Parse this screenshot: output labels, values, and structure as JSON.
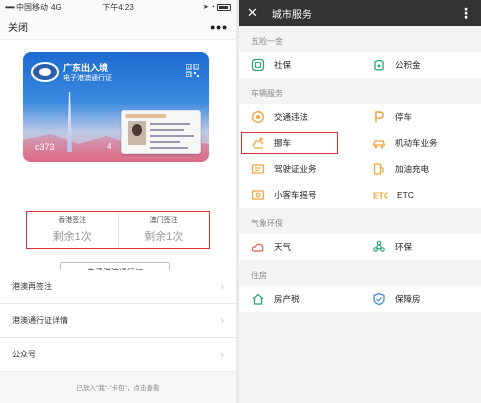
{
  "left": {
    "status": {
      "carrier": "中国移动",
      "network": "4G",
      "time": "下午4:23"
    },
    "nav": {
      "close_label": "关闭",
      "more_label": "•••"
    },
    "card": {
      "title": "广东出入境",
      "subtitle": "电子港澳通行证",
      "number_prefix": "c373",
      "number_suffix": "4"
    },
    "quota": [
      {
        "label": "香港签注",
        "value": "剩余1次"
      },
      {
        "label": "澳门签注",
        "value": "剩余1次"
      }
    ],
    "eep_button": "电子港澳通行证",
    "list": [
      {
        "label": "港澳再签注",
        "chevron": "›"
      },
      {
        "label": "港澳通行证详情",
        "chevron": "›"
      },
      {
        "label": "公众号",
        "chevron": "›"
      }
    ],
    "footer_note": "已放入\"我\"-\"卡包\"，点击查看"
  },
  "right": {
    "header": {
      "close_label": "✕",
      "title": "城市服务",
      "more_label": "⋮"
    },
    "sections": [
      {
        "title": "五险一金",
        "items": [
          {
            "label": "社保",
            "icon": "social-security-icon"
          },
          {
            "label": "公积金",
            "icon": "provident-fund-icon"
          }
        ]
      },
      {
        "title": "车辆服务",
        "items": [
          {
            "label": "交通违法",
            "icon": "traffic-violation-icon"
          },
          {
            "label": "停车",
            "icon": "parking-icon"
          },
          {
            "label": "挪车",
            "icon": "move-car-icon"
          },
          {
            "label": "机动车业务",
            "icon": "vehicle-business-icon"
          },
          {
            "label": "驾驶证业务",
            "icon": "driver-license-icon"
          },
          {
            "label": "加油充电",
            "icon": "fuel-charge-icon"
          },
          {
            "label": "小客车摇号",
            "icon": "car-lottery-icon"
          },
          {
            "label": "ETC",
            "icon": "etc-icon"
          }
        ]
      },
      {
        "title": "气象环保",
        "items": [
          {
            "label": "天气",
            "icon": "weather-icon"
          },
          {
            "label": "环保",
            "icon": "environment-icon"
          }
        ]
      },
      {
        "title": "住房",
        "items": [
          {
            "label": "房产税",
            "icon": "property-tax-icon"
          },
          {
            "label": "保障房",
            "icon": "affordable-housing-icon"
          }
        ]
      }
    ]
  },
  "colors": {
    "accent_red": "#d73030",
    "icon_green": "#2aa57c",
    "icon_orange": "#f2a33a",
    "icon_blue": "#3f8bd9",
    "header_dark": "#333333"
  }
}
